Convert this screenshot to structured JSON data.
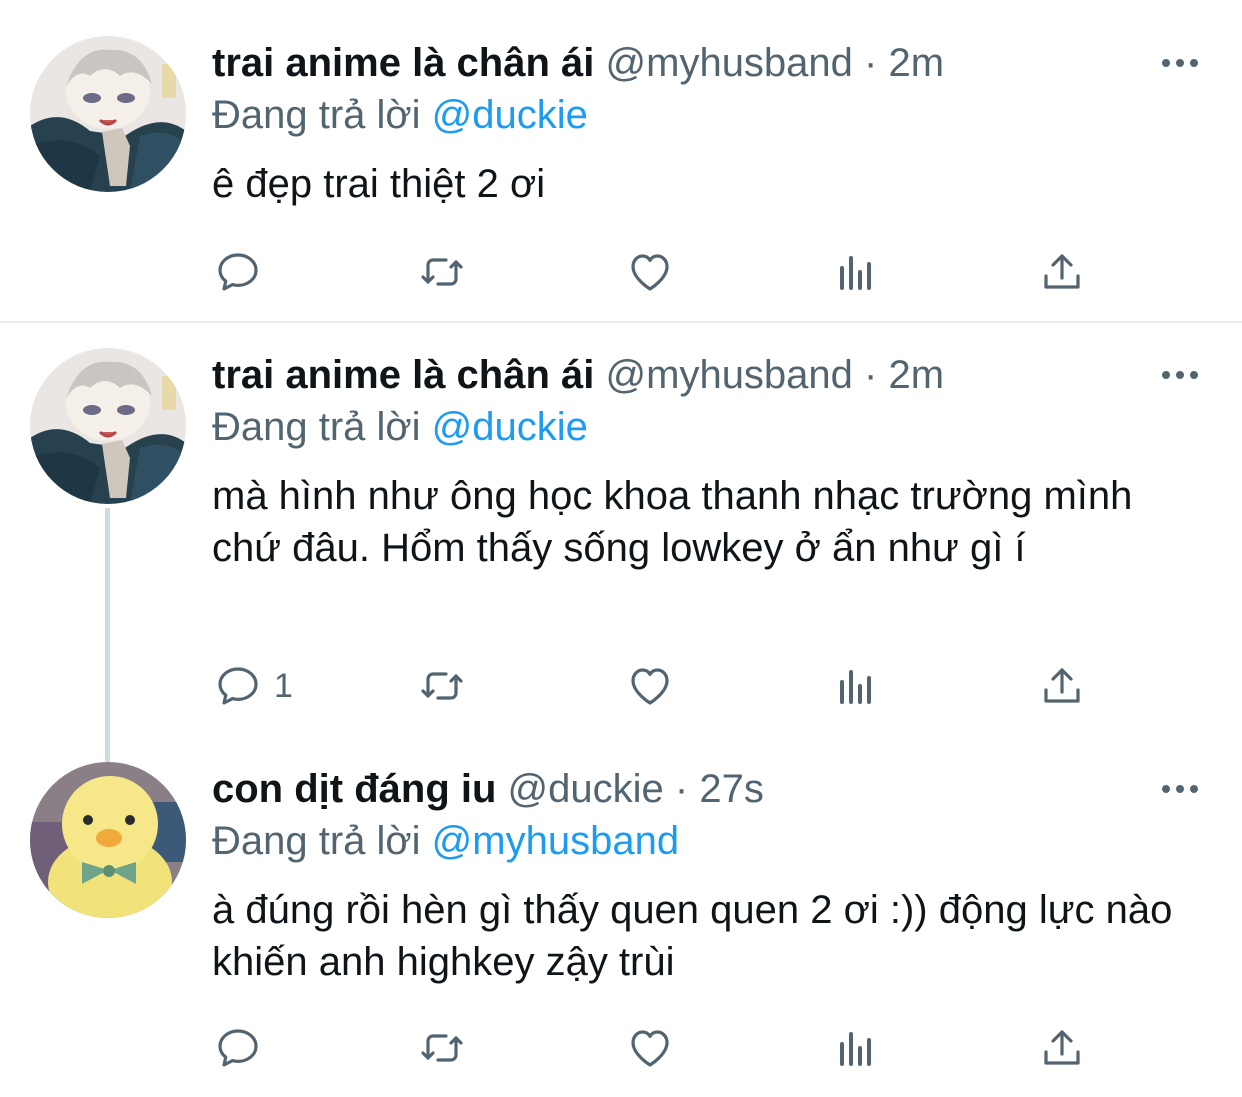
{
  "colors": {
    "link": "#1d9bf0",
    "muted": "#536471",
    "text": "#0f1419",
    "divider": "#e6ecf0",
    "thread_line": "#cfd9de"
  },
  "icons": [
    "reply-icon",
    "retweet-icon",
    "like-icon",
    "analytics-icon",
    "share-icon",
    "more-icon"
  ],
  "tweets": [
    {
      "display_name": "trai anime là chân ái",
      "handle": "@myhusband",
      "separator": "·",
      "time": "2m",
      "replying_prefix": "Đang trả lời",
      "replying_to": "@duckie",
      "text": "ê đẹp trai thiệt 2 ơi",
      "reply_count": ""
    },
    {
      "display_name": "trai anime là chân ái",
      "handle": "@myhusband",
      "separator": "·",
      "time": "2m",
      "replying_prefix": "Đang trả lời",
      "replying_to": "@duckie",
      "text": "mà hình như ông học khoa thanh nhạc trường mình chứ đâu. Hổm thấy sống lowkey ở ẩn như gì í",
      "reply_count": "1"
    },
    {
      "display_name": "con dịt đáng iu",
      "handle": "@duckie",
      "separator": "·",
      "time": "27s",
      "replying_prefix": "Đang trả lời",
      "replying_to": "@myhusband",
      "text": "à đúng rồi hèn gì thấy quen quen 2 ơi :)) động lực nào khiến anh highkey zậy trùi",
      "reply_count": ""
    }
  ]
}
